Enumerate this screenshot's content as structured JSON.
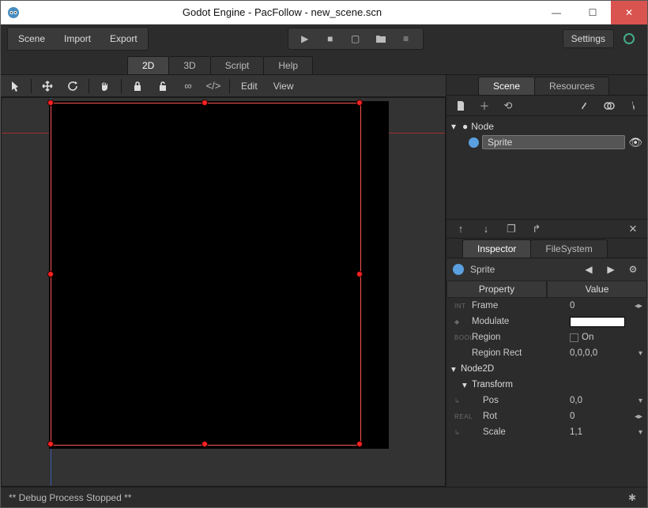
{
  "title": "Godot Engine - PacFollow - new_scene.scn",
  "menu": {
    "scene": "Scene",
    "import": "Import",
    "export": "Export"
  },
  "play": {
    "play": "▶",
    "pause": "■",
    "play_scene": "▢",
    "folder": "📁",
    "list": "≡"
  },
  "settings_label": "Settings",
  "workspace_tabs": {
    "t0": "2D",
    "t1": "3D",
    "t2": "Script",
    "t3": "Help"
  },
  "canvas_toolbar": {
    "edit": "Edit",
    "view": "View"
  },
  "right_tabs": {
    "scene": "Scene",
    "resources": "Resources"
  },
  "scene_tree": {
    "root": "Node",
    "child0": "Sprite"
  },
  "inspector_tabs": {
    "insp": "Inspector",
    "fs": "FileSystem"
  },
  "inspector": {
    "title": "Sprite",
    "headers": {
      "prop": "Property",
      "val": "Value"
    },
    "rows": {
      "frame_k": "Frame",
      "frame_v": "0",
      "frame_hint": "INT",
      "modulate_k": "Modulate",
      "region_k": "Region",
      "region_v": "On",
      "region_hint": "BOOL",
      "regionrect_k": "Region Rect",
      "regionrect_v": "0,0,0,0"
    },
    "groups": {
      "node2d": "Node2D",
      "transform": "Transform"
    },
    "tx": {
      "pos_k": "Pos",
      "pos_v": "0,0",
      "rot_k": "Rot",
      "rot_v": "0",
      "rot_hint": "REAL",
      "scale_k": "Scale",
      "scale_v": "1,1"
    }
  },
  "status": "** Debug Process Stopped **"
}
